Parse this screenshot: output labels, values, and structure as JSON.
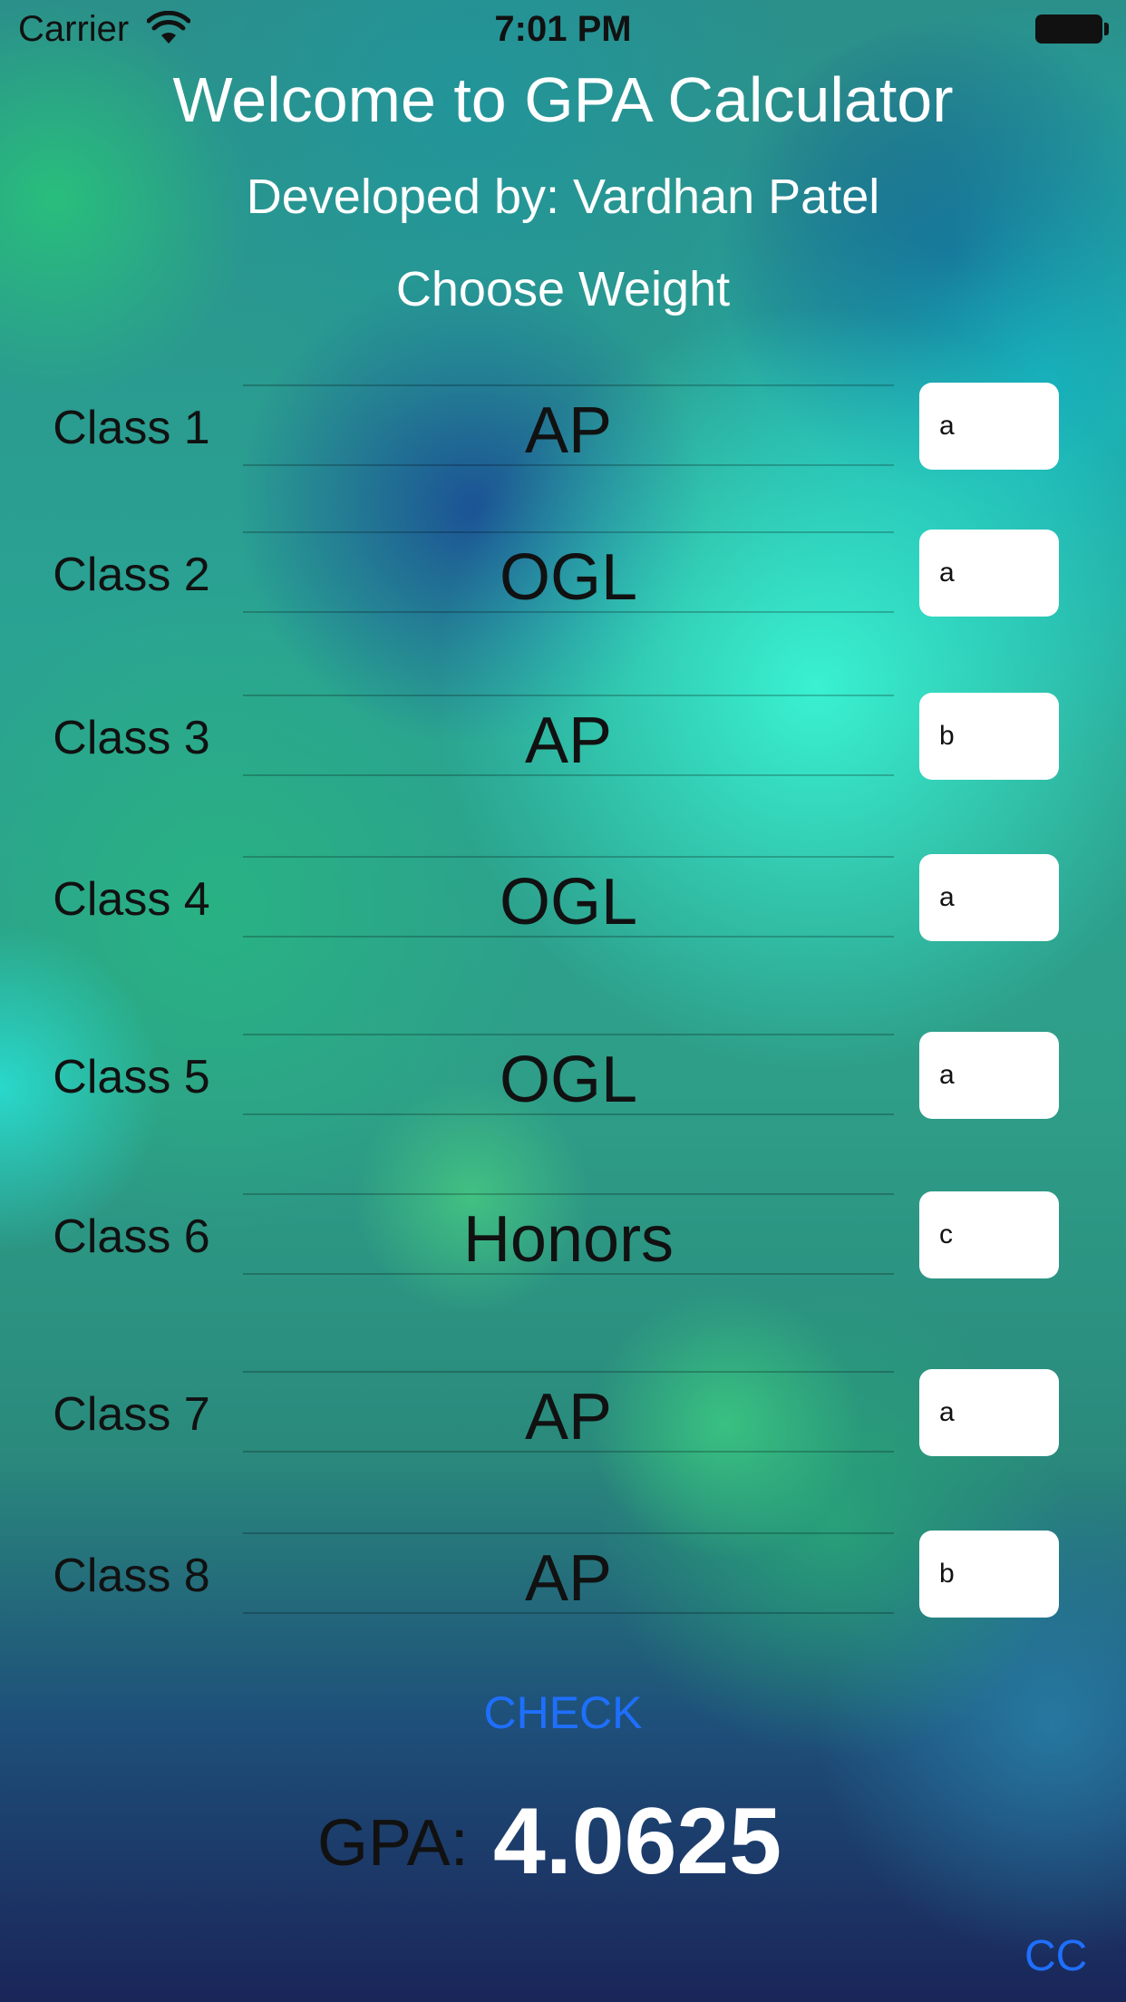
{
  "status_bar": {
    "carrier": "Carrier",
    "time": "7:01 PM"
  },
  "header": {
    "title": "Welcome to GPA Calculator",
    "subtitle": "Developed by: Vardhan Patel",
    "weight_label": "Choose Weight"
  },
  "classes": [
    {
      "label": "Class 1",
      "weight": "AP",
      "grade": "a"
    },
    {
      "label": "Class 2",
      "weight": "OGL",
      "grade": "a"
    },
    {
      "label": "Class 3",
      "weight": "AP",
      "grade": "b"
    },
    {
      "label": "Class 4",
      "weight": "OGL",
      "grade": "a"
    },
    {
      "label": "Class 5",
      "weight": "OGL",
      "grade": "a"
    },
    {
      "label": "Class 6",
      "weight": "Honors",
      "grade": "c"
    },
    {
      "label": "Class 7",
      "weight": "AP",
      "grade": "a"
    },
    {
      "label": "Class 8",
      "weight": "AP",
      "grade": "b"
    }
  ],
  "actions": {
    "check_label": "CHECK",
    "cc_label": "CC"
  },
  "result": {
    "gpa_label": "GPA:",
    "gpa_value": "4.0625"
  },
  "colors": {
    "accent": "#1f6fff",
    "title_text": "#ffffff",
    "body_text": "#111111"
  }
}
